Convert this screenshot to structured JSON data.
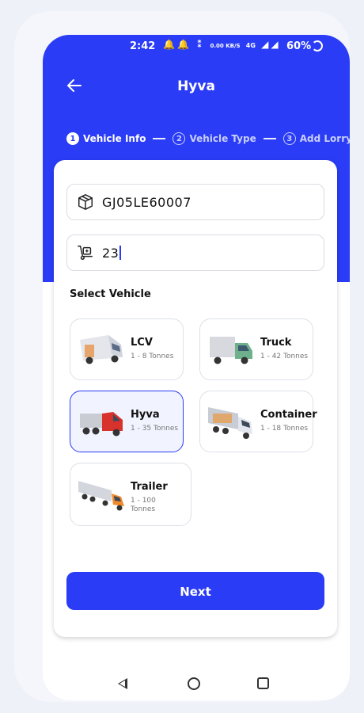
{
  "status_bar": {
    "time": "2:42",
    "speed": "0.00 KB/S",
    "network": "4G",
    "battery": "60%"
  },
  "header": {
    "title": "Hyva",
    "back_icon": "arrow-left-icon"
  },
  "stepper": {
    "steps": [
      {
        "number": "1",
        "label": "Vehicle Info",
        "active": true
      },
      {
        "number": "2",
        "label": "Vehicle Type",
        "active": false
      },
      {
        "number": "3",
        "label": "Add Lorry",
        "active": false
      }
    ]
  },
  "form": {
    "vehicle_number": {
      "value": "GJ05LE60007",
      "icon": "package-box-icon"
    },
    "capacity": {
      "value": "23",
      "icon": "hand-truck-icon"
    }
  },
  "select_vehicle": {
    "title": "Select Vehicle",
    "selected": "Hyva",
    "options": [
      {
        "name": "LCV",
        "capacity": "1 - 8 Tonnes"
      },
      {
        "name": "Truck",
        "capacity": "1 - 42 Tonnes"
      },
      {
        "name": "Hyva",
        "capacity": "1 - 35 Tonnes"
      },
      {
        "name": "Container",
        "capacity": "1 - 18 Tonnes"
      },
      {
        "name": "Trailer",
        "capacity": "1 - 100 Tonnes"
      }
    ]
  },
  "actions": {
    "next_label": "Next"
  },
  "colors": {
    "primary": "#2a3cf6",
    "background": "#ffffff"
  }
}
